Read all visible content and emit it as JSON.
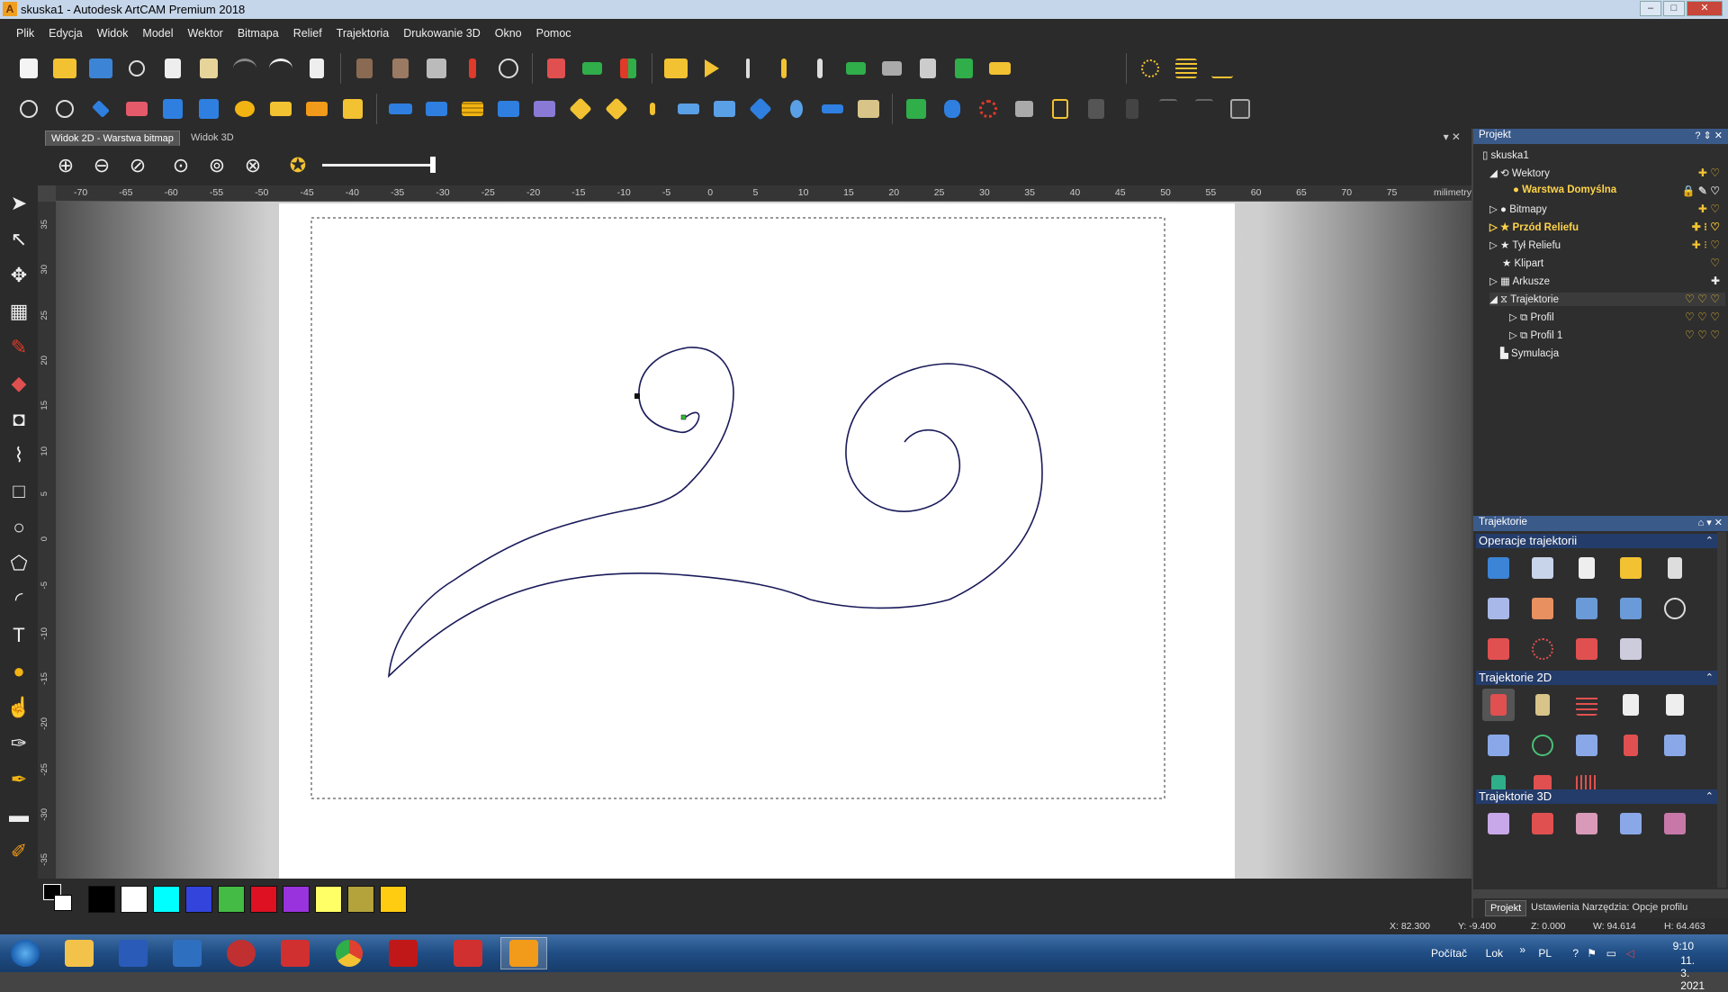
{
  "window": {
    "title": "skuska1 - Autodesk ArtCAM Premium 2018",
    "app_icon": "A",
    "controls": [
      "–",
      "□",
      "✕"
    ]
  },
  "menu": [
    "Plik",
    "Edycja",
    "Widok",
    "Model",
    "Wektor",
    "Bitmapa",
    "Relief",
    "Trajektoria",
    "Drukowanie 3D",
    "Okno",
    "Pomoc"
  ],
  "view_tabs": {
    "active": "Widok 2D - Warstwa bitmap",
    "inactive": "Widok 3D",
    "controls": "▾  ✕"
  },
  "zoom_tools": [
    "zoom-in-icon",
    "zoom-out-icon",
    "zoom-previous-icon",
    "zoom-1to1-icon",
    "zoom-fit-icon",
    "zoom-all-icon",
    "pin-icon"
  ],
  "ruler": {
    "unit": "milimetry",
    "h_ticks": [
      "-70",
      "-65",
      "-60",
      "-55",
      "-50",
      "-45",
      "-40",
      "-35",
      "-30",
      "-25",
      "-20",
      "-15",
      "-10",
      "-5",
      "0",
      "5",
      "10",
      "15",
      "20",
      "25",
      "30",
      "35",
      "40",
      "45",
      "50",
      "55",
      "60",
      "65",
      "70",
      "75"
    ],
    "v_ticks": [
      "35",
      "30",
      "25",
      "20",
      "15",
      "10",
      "5",
      "0",
      "-5",
      "-10",
      "-15",
      "-20",
      "-25",
      "-30",
      "-35"
    ]
  },
  "palette": {
    "colors": [
      "#000000",
      "#ffffff",
      "#00ffff",
      "#3344dd",
      "#44bb44",
      "#dd1122",
      "#9933dd",
      "#ffff66",
      "#b3a33a",
      "#ffcc11"
    ]
  },
  "project_panel": {
    "title": "Projekt",
    "header_controls": "? ⇕ ✕",
    "tree": [
      {
        "label": "skuska1"
      },
      {
        "label": "Wektory"
      },
      {
        "label": "Warstwa Domyślna"
      },
      {
        "label": "Bitmapy"
      },
      {
        "label": "Przód Reliefu"
      },
      {
        "label": "Tył Reliefu"
      },
      {
        "label": "Klipart"
      },
      {
        "label": "Arkusze"
      },
      {
        "label": "Trajektorie"
      },
      {
        "label": "Profil"
      },
      {
        "label": "Profil 1"
      },
      {
        "label": "Symulacja"
      }
    ]
  },
  "traj_panel": {
    "title": "Trajektorie",
    "header_controls": "⌂ ▾ ✕",
    "sections": [
      "Operacje trajektorii",
      "Trajektorie 2D",
      "Trajektorie 3D"
    ]
  },
  "bottom_tabs": [
    "Projekt",
    "Ustawienia Narzędzia: Opcje profilu"
  ],
  "status": {
    "x": "X: 82.300",
    "y": "Y: -9.400",
    "z": "Z: 0.000",
    "w": "W: 94.614",
    "h": "H: 64.463"
  },
  "tray": {
    "left_text": "Počítač",
    "lok": "Lok",
    "lang": "PL",
    "time": "9:10",
    "date": "11. 3. 2021"
  }
}
